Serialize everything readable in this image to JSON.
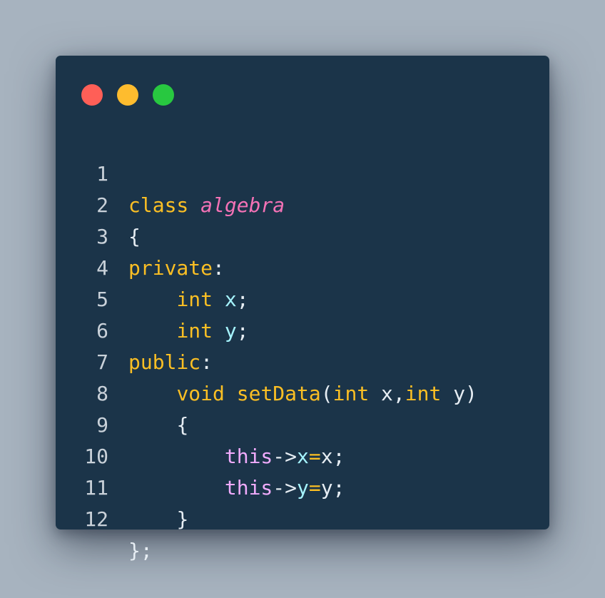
{
  "window": {
    "buttons": [
      "close",
      "minimize",
      "maximize"
    ],
    "colors": {
      "background": "#1b3449",
      "close": "#ff5f57",
      "minimize": "#febc2e",
      "maximize": "#28c840"
    }
  },
  "code": {
    "language": "C++",
    "lines": [
      {
        "number": "1",
        "tokens": [
          "class",
          " ",
          "algebra"
        ]
      },
      {
        "number": "2",
        "tokens": [
          "{"
        ]
      },
      {
        "number": "3",
        "tokens": [
          "private",
          ":"
        ]
      },
      {
        "number": "4",
        "tokens": [
          "    ",
          "int",
          " ",
          "x",
          ";"
        ]
      },
      {
        "number": "5",
        "tokens": [
          "    ",
          "int",
          " ",
          "y",
          ";"
        ]
      },
      {
        "number": "6",
        "tokens": [
          "public",
          ":"
        ]
      },
      {
        "number": "7",
        "tokens": [
          "    ",
          "void",
          " ",
          "setData",
          "(",
          "int",
          " x,",
          "int",
          " y)"
        ]
      },
      {
        "number": "8",
        "tokens": [
          "    ",
          "{"
        ]
      },
      {
        "number": "9",
        "tokens": [
          "        ",
          "this",
          "->",
          "x",
          "=",
          "x;"
        ]
      },
      {
        "number": "10",
        "tokens": [
          "        ",
          "this",
          "->",
          "y",
          "=",
          "y;"
        ]
      },
      {
        "number": "11",
        "tokens": [
          "    ",
          "}"
        ]
      },
      {
        "number": "12",
        "tokens": [
          "};"
        ]
      }
    ]
  }
}
